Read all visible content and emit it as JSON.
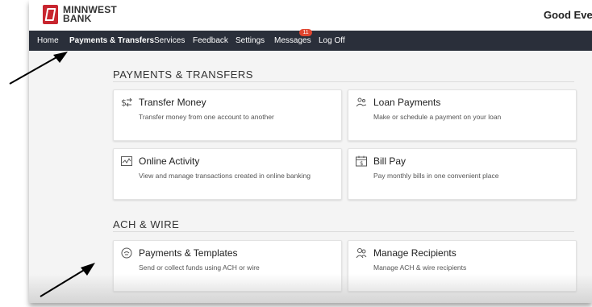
{
  "header": {
    "brand_line1": "MINNWEST",
    "brand_line2": "BANK",
    "greeting": "Good Eveni"
  },
  "nav": {
    "items": [
      {
        "label": "Home"
      },
      {
        "label": "Payments & Transfers"
      },
      {
        "label": "Services"
      },
      {
        "label": "Feedback"
      },
      {
        "label": "Settings"
      },
      {
        "label": "Messages"
      },
      {
        "label": "Log Off"
      }
    ],
    "messages_badge": "11",
    "active_item": "Payments & Transfers"
  },
  "sections": [
    {
      "title": "PAYMENTS & TRANSFERS",
      "cards": [
        {
          "title": "Transfer Money",
          "description": "Transfer money from one account to another",
          "icon": "transfer-icon"
        },
        {
          "title": "Loan Payments",
          "description": "Make or schedule a payment on your loan",
          "icon": "loan-icon"
        },
        {
          "title": "Online Activity",
          "description": "View and manage transactions created in online banking",
          "icon": "activity-chart-icon"
        },
        {
          "title": "Bill Pay",
          "description": "Pay monthly bills in one convenient place",
          "icon": "bill-calendar-icon"
        }
      ]
    },
    {
      "title": "ACH & WIRE",
      "cards": [
        {
          "title": "Payments & Templates",
          "description": "Send or collect funds using ACH or wire",
          "icon": "payments-templates-icon"
        },
        {
          "title": "Manage Recipients",
          "description": "Manage ACH & wire recipients",
          "icon": "recipients-icon"
        }
      ]
    }
  ],
  "colors": {
    "brand_red": "#c8262f",
    "nav_background": "#2a2f3a",
    "badge": "#e0452f",
    "page_background": "#f4f4f4"
  }
}
